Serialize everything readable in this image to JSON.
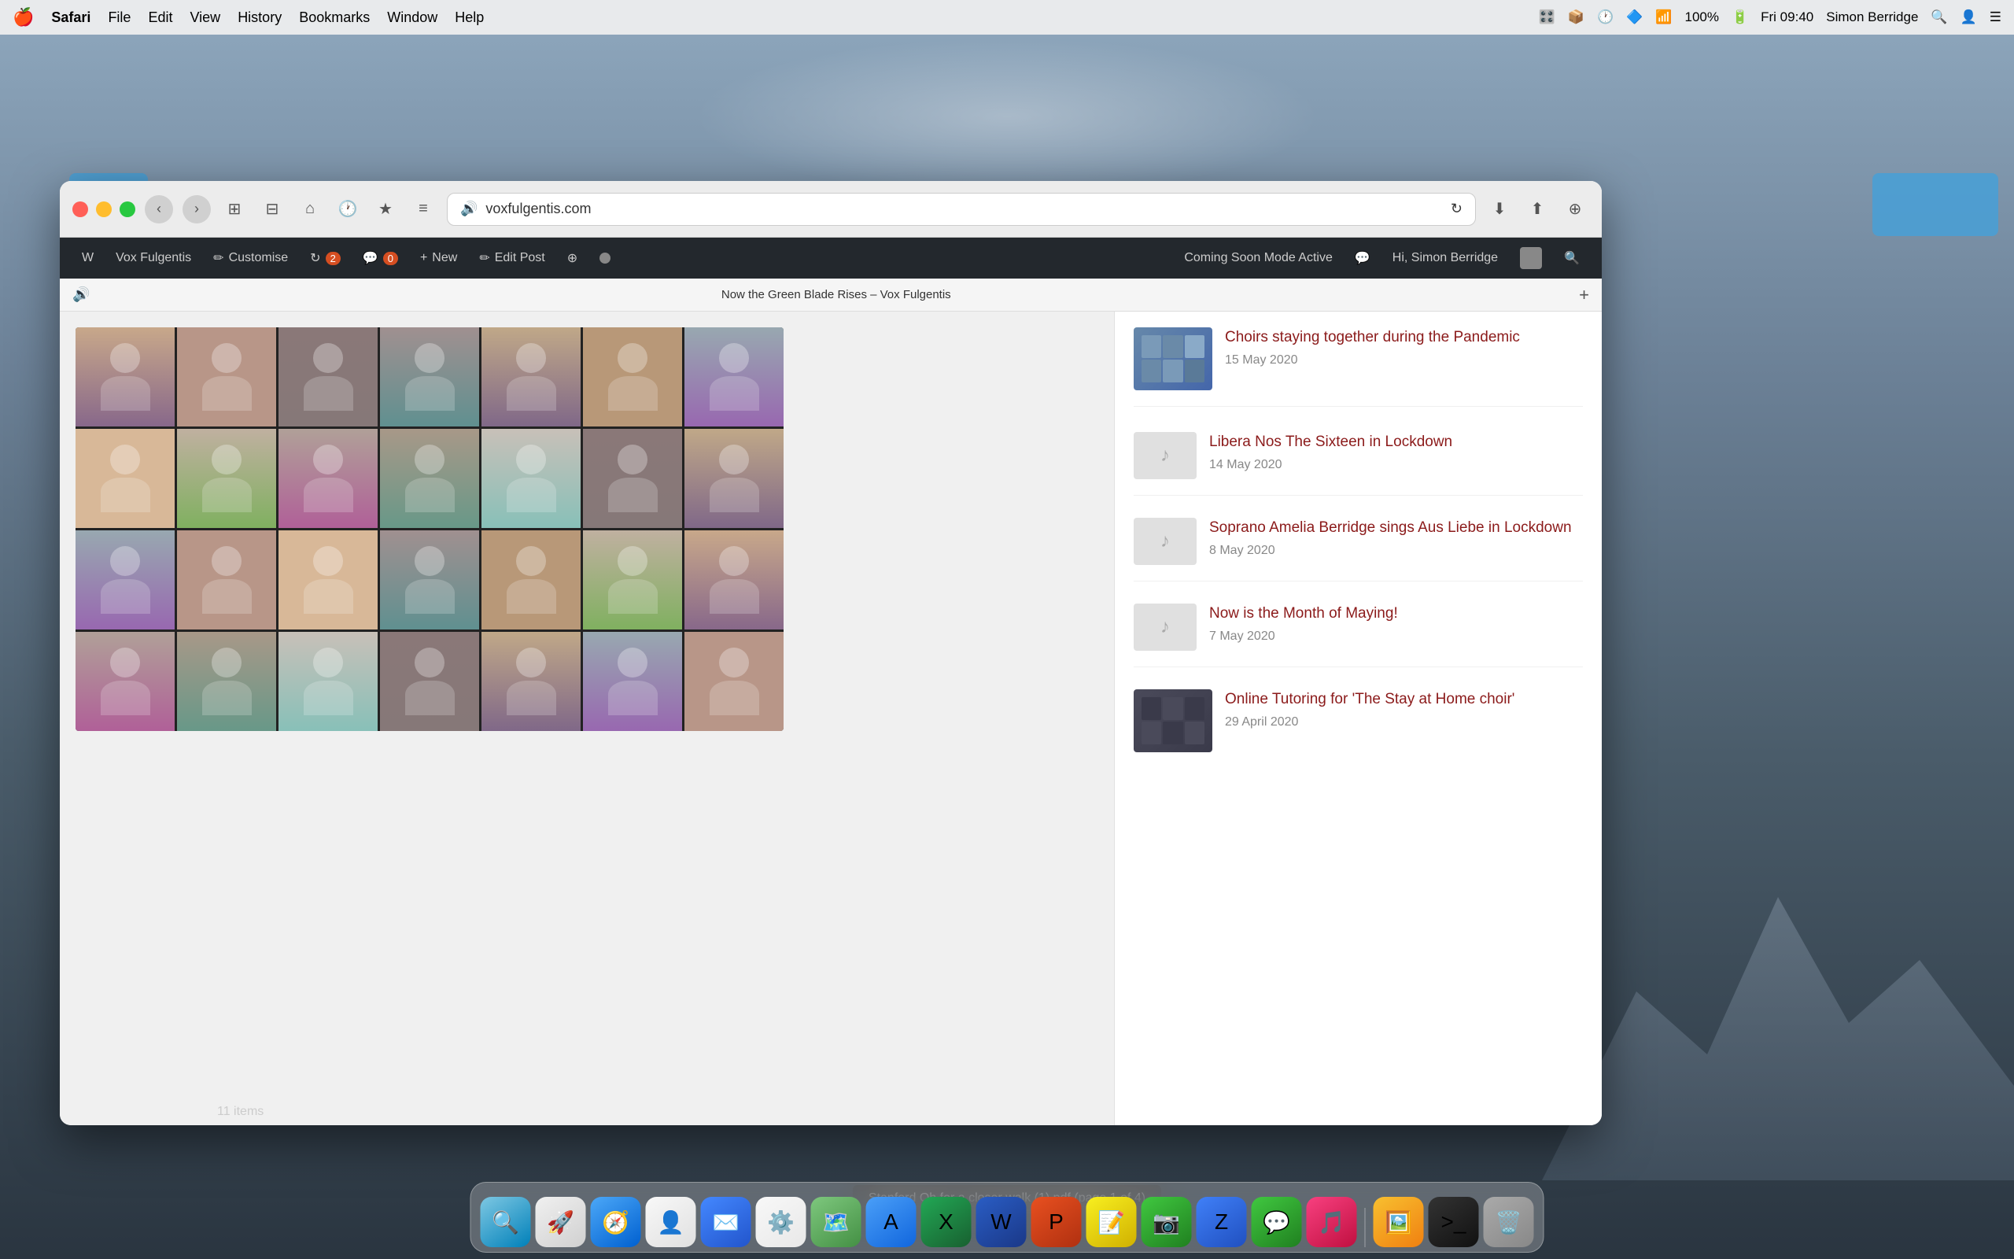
{
  "menubar": {
    "apple": "🍎",
    "items": [
      "Safari",
      "File",
      "Edit",
      "View",
      "History",
      "Bookmarks",
      "Window",
      "Help"
    ],
    "time": "Fri 09:40",
    "user": "Simon Berridge",
    "battery": "100%"
  },
  "browser": {
    "url": "voxfulgentis.com",
    "tab_title": "Now the Green Blade Rises – Vox Fulgentis"
  },
  "wp_admin_bar": {
    "wp_icon": "W",
    "vox_fulgentis": "Vox Fulgentis",
    "customise": "Customise",
    "updates_count": "2",
    "comments_count": "0",
    "new": "New",
    "edit_post": "Edit Post",
    "coming_soon": "Coming Soon Mode Active",
    "hi_user": "Hi, Simon Berridge"
  },
  "sidebar": {
    "posts": [
      {
        "id": 1,
        "title": "Choirs staying together during the Pandemic",
        "date": "15 May 2020",
        "has_thumb": true,
        "thumb_type": "choir"
      },
      {
        "id": 2,
        "title": "Libera Nos The Sixteen in Lockdown",
        "date": "14 May 2020",
        "has_thumb": false
      },
      {
        "id": 3,
        "title": "Soprano Amelia Berridge sings Aus Liebe in Lockdown",
        "date": "8 May 2020",
        "has_thumb": false
      },
      {
        "id": 4,
        "title": "Now is the Month of Maying!",
        "date": "7 May 2020",
        "has_thumb": false
      },
      {
        "id": 5,
        "title": "Online Tutoring for 'The Stay at Home choir'",
        "date": "29 April 2020",
        "has_thumb": true,
        "thumb_type": "zoom"
      }
    ]
  },
  "status_bar": {
    "text": "Stanford Oh for a closer walk (1).pdf (page 1 of 4)"
  },
  "file_count": {
    "text": "11 items"
  },
  "dock": {
    "items": [
      {
        "name": "Finder",
        "icon": "🔍",
        "class": "d-finder"
      },
      {
        "name": "Launchpad",
        "icon": "🚀",
        "class": "d-launchpad"
      },
      {
        "name": "Safari",
        "icon": "🧭",
        "class": "d-safari"
      },
      {
        "name": "Contacts",
        "icon": "👤",
        "class": "d-contacts"
      },
      {
        "name": "Mail",
        "icon": "✉️",
        "class": "d-mail"
      },
      {
        "name": "Chrome",
        "icon": "⚙️",
        "class": "d-chrome"
      },
      {
        "name": "Maps",
        "icon": "🗺️",
        "class": "d-maps"
      },
      {
        "name": "App Store",
        "icon": "A",
        "class": "d-appstore"
      },
      {
        "name": "Excel",
        "icon": "X",
        "class": "d-excel"
      },
      {
        "name": "Word",
        "icon": "W",
        "class": "d-word"
      },
      {
        "name": "PowerPoint",
        "icon": "P",
        "class": "d-ppt"
      },
      {
        "name": "Notes",
        "icon": "📝",
        "class": "d-notes"
      },
      {
        "name": "FaceTime",
        "icon": "📷",
        "class": "d-facetime"
      },
      {
        "name": "Zoom",
        "icon": "Z",
        "class": "d-zoom"
      },
      {
        "name": "Messages",
        "icon": "💬",
        "class": "d-messages"
      },
      {
        "name": "Music",
        "icon": "🎵",
        "class": "d-music"
      },
      {
        "name": "Photos",
        "icon": "🖼️",
        "class": "d-photos"
      },
      {
        "name": "Terminal",
        "icon": ">_",
        "class": "d-terminal"
      },
      {
        "name": "Trash",
        "icon": "🗑️",
        "class": "d-trash"
      }
    ]
  },
  "video_grid": {
    "rows": 4,
    "cols": 7,
    "people": [
      "person-1",
      "person-2",
      "person-3",
      "person-4",
      "person-5",
      "person-6",
      "person-7",
      "person-8",
      "person-9",
      "person-10",
      "person-11",
      "person-12",
      "person-3",
      "person-5",
      "person-7",
      "person-2",
      "person-8",
      "person-4",
      "person-6",
      "person-9",
      "person-1",
      "person-10",
      "person-11",
      "person-12",
      "person-3",
      "person-5",
      "person-7",
      "person-2"
    ]
  }
}
